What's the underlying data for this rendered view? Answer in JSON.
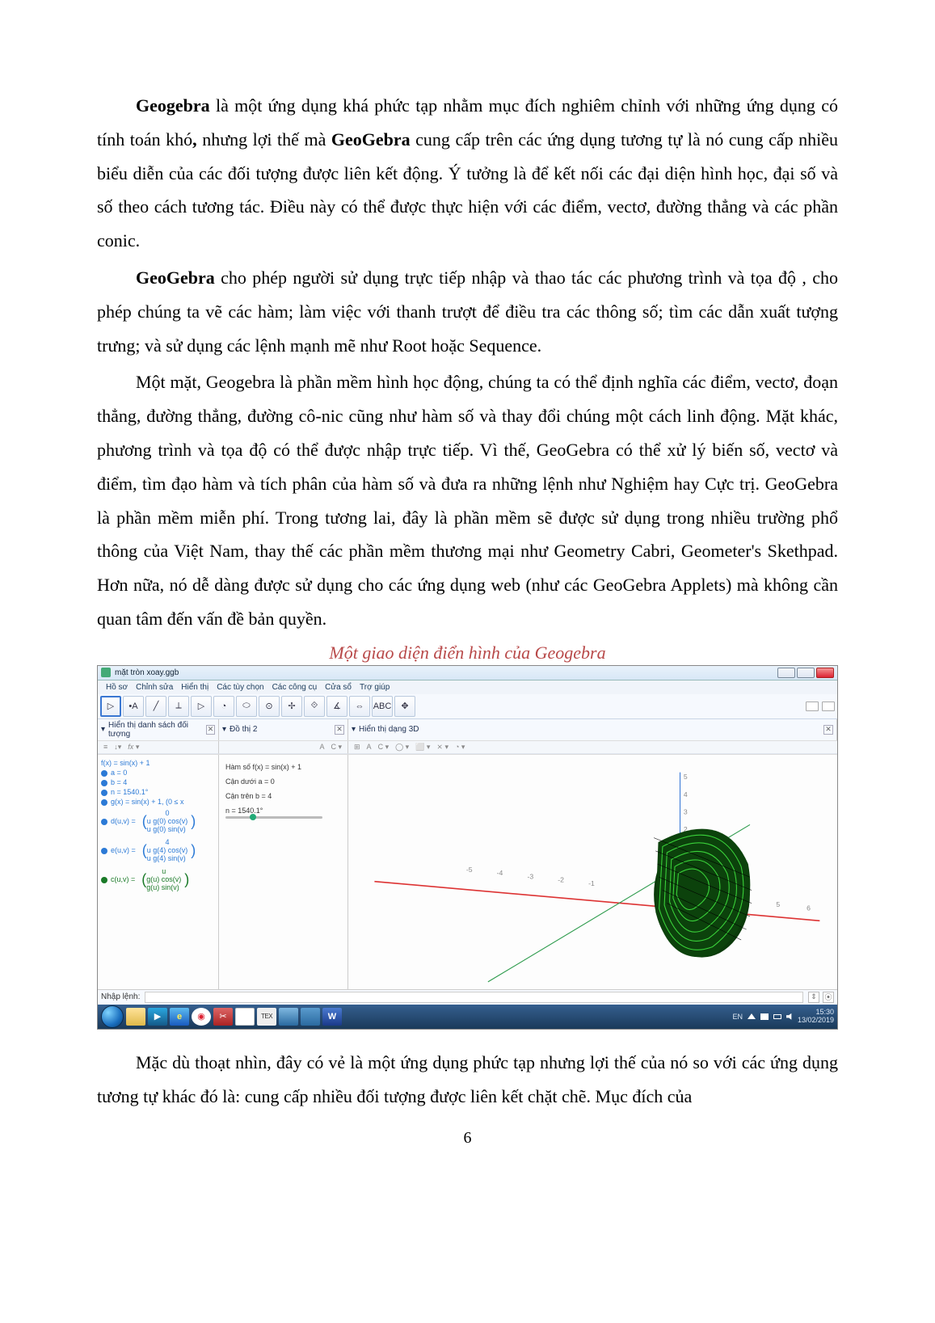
{
  "para1_b1": "Geogebra",
  "para1_a": " là một ứng dụng khá phức tạp nhằm mục đích nghiêm chỉnh với những ứng dụng có tính toán khó",
  "para1_b2": ",",
  "para1_b": " nhưng lợi thế mà ",
  "para1_b3": "GeoGebra",
  "para1_c": " cung cấp trên các ứng dụng tương tự là nó cung cấp nhiều biểu diễn của các đối tượng được liên kết động. Ý tưởng là để kết nối các đại diện hình học, đại số và số theo cách tương tác. Điều này có thể được thực hiện với các điểm, vectơ, đường thẳng và các phần conic.",
  "para2_b1": "GeoGebra",
  "para2_a": " cho phép người sử dụng trực tiếp nhập và thao tác các phương trình và tọa độ , cho phép chúng ta vẽ các hàm; làm việc với thanh trượt để điều tra các thông số; tìm các dẫn xuất tượng trưng; và sử dụng các lệnh mạnh mẽ như Root hoặc Sequence.",
  "para3": "Một mặt, Geogebra là phần mềm hình học động, chúng ta có thể định nghĩa các điểm, vectơ, đoạn thẳng, đường thẳng, đường cô-nic cũng như hàm số và thay đổi chúng một cách linh động. Mặt khác, phương trình và tọa độ có thể được nhập trực tiếp. Vì thế, GeoGebra có thể xử lý biến số, vectơ và điểm, tìm đạo hàm và tích phân của hàm số và đưa ra những lệnh như Nghiệm hay Cực trị. GeoGebra là phần mềm miễn phí. Trong tương lai, đây là phần mềm sẽ được sử dụng trong nhiều trường phổ thông của Việt Nam, thay thế các phần mềm thương mại như Geometry Cabri, Geometer's Skethpad. Hơn nữa, nó dễ dàng được sử dụng cho các ứng dụng web (như các GeoGebra Applets) mà không cần quan tâm đến vấn đề bản quyền.",
  "caption": "Một giao diện điển hình của Geogebra",
  "para4": "Mặc dù thoạt nhìn, đây có vẻ là một ứng dụng phức tạp nhưng lợi thế của nó so với các ứng dụng tương tự khác đó là: cung cấp nhiều đối tượng được liên kết chặt chẽ. Mục đích của",
  "page_num": "6",
  "shot": {
    "title": "mặt tròn xoay.ggb",
    "menus": [
      "Hồ sơ",
      "Chỉnh sửa",
      "Hiển thị",
      "Các tùy chọn",
      "Các công cụ",
      "Cửa sổ",
      "Trợ giúp"
    ],
    "tool_labels": [
      "▷",
      "•A",
      "╱",
      "⟂",
      "▷",
      "◔",
      "⬭",
      "⊙",
      "✢",
      "⟐",
      "∡",
      "⇔",
      "ABC",
      "✥"
    ],
    "panel1": "Hiển thị danh sách đối tượng",
    "panel2": "Đồ thị 2",
    "panel3": "Hiển thị dạng 3D",
    "sub2_items": [
      "A",
      "C ▾"
    ],
    "sub3_items": [
      "A",
      "C ▾",
      "◯ ▾",
      "⬜ ▾",
      "⨯ ▾",
      "◔ ▾"
    ],
    "alg": {
      "fx": "f(x) = sin(x) + 1",
      "a": "a = 0",
      "b": "b = 4",
      "n": "n = 1540.1°",
      "gx": "g(x) = sin(x) + 1,   (0 ≤ x",
      "d_top": "0",
      "d_label": "d(u,v) =",
      "d_l1": "u g(0) cos(v)",
      "d_l2": "u g(0) sin(v)",
      "e_top": "4",
      "e_label": "e(u,v) =",
      "e_l1": "u g(4) cos(v)",
      "e_l2": "u g(4) sin(v)",
      "c_top": "u",
      "c_label": "c(u,v) =",
      "c_l1": "g(u) cos(v)",
      "c_l2": "g(u) sin(v)"
    },
    "g2d": {
      "l1": "Hàm số f(x) = sin(x) + 1",
      "l2": "Cận dưới a = 0",
      "l3": "Cận trên b = 4",
      "l4": "n = 1540.1°"
    },
    "input_label": "Nhập lệnh:",
    "taskbar": {
      "tex": "TEX",
      "w": "W",
      "lang": "EN",
      "time": "15:30",
      "date": "13/02/2019"
    }
  }
}
